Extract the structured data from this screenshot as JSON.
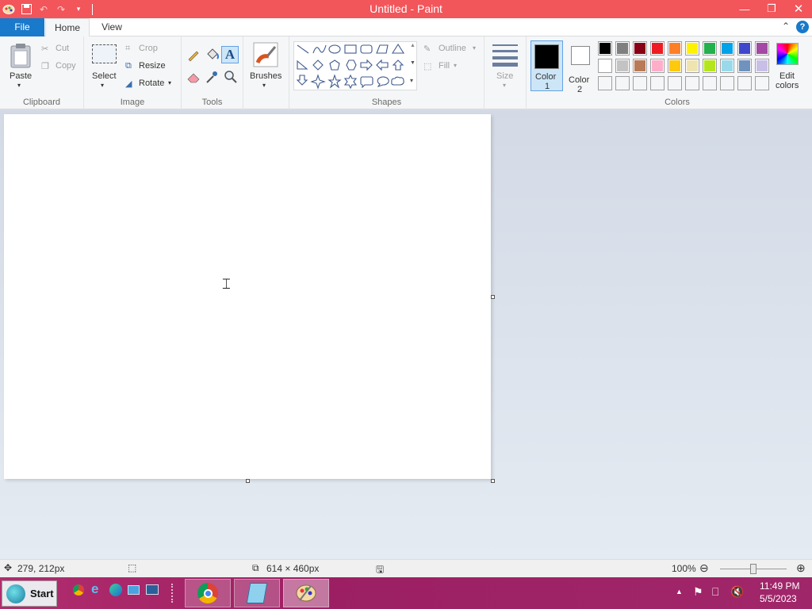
{
  "window": {
    "title": "Untitled - Paint"
  },
  "menu": {
    "file": "File",
    "home": "Home",
    "view": "View"
  },
  "ribbon": {
    "clipboard": {
      "paste": "Paste",
      "cut": "Cut",
      "copy": "Copy",
      "label": "Clipboard"
    },
    "image": {
      "select": "Select",
      "crop": "Crop",
      "resize": "Resize",
      "rotate": "Rotate",
      "label": "Image"
    },
    "tools": {
      "label": "Tools"
    },
    "brushes": {
      "label": "Brushes"
    },
    "shapes": {
      "outline": "Outline",
      "fill": "Fill",
      "label": "Shapes"
    },
    "size": {
      "label": "Size"
    },
    "color1": {
      "line1": "Color",
      "line2": "1",
      "color": "#000000"
    },
    "color2": {
      "line1": "Color",
      "line2": "2",
      "color": "#ffffff"
    },
    "colors": {
      "label": "Colors",
      "edit_line1": "Edit",
      "edit_line2": "colors",
      "row1": [
        "#000000",
        "#7f7f7f",
        "#880015",
        "#ed1c24",
        "#ff7f27",
        "#fff200",
        "#22b14c",
        "#00a2e8",
        "#3f48cc",
        "#a349a4"
      ],
      "row2": [
        "#ffffff",
        "#c3c3c3",
        "#b97a57",
        "#ffaec9",
        "#ffc90e",
        "#efe4b0",
        "#b5e61d",
        "#99d9ea",
        "#7092be",
        "#c8bfe7"
      ]
    }
  },
  "status": {
    "cursor_pos": "279, 212px",
    "canvas_size": "614 × 460px",
    "zoom": "100%"
  },
  "taskbar": {
    "start": "Start",
    "time": "11:49 PM",
    "date": "5/5/2023"
  }
}
